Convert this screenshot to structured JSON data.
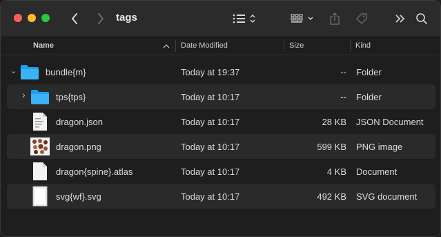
{
  "window": {
    "title": "tags"
  },
  "toolbar": {
    "back_icon": "chevron-left-icon",
    "forward_icon": "chevron-right-icon",
    "list_view_icon": "list-view-icon",
    "grid_view_icon": "grid-view-icon",
    "share_icon": "share-icon",
    "tag_icon": "tag-icon",
    "more_icon": "double-chevron-icon",
    "search_icon": "search-icon"
  },
  "columns": {
    "name": "Name",
    "date": "Date Modified",
    "size": "Size",
    "kind": "Kind"
  },
  "files": [
    {
      "disclosure": "⌄",
      "name": "bundle{m}",
      "date": "Today at 19:37",
      "size": "--",
      "kind": "Folder",
      "icon": "folder-icon"
    },
    {
      "disclosure": "›",
      "name": "tps{tps}",
      "date": "Today at 10:17",
      "size": "--",
      "kind": "Folder",
      "icon": "folder-icon"
    },
    {
      "disclosure": "",
      "name": "dragon.json",
      "date": "Today at 10:17",
      "size": "28 KB",
      "kind": "JSON Document",
      "icon": "json-document-icon"
    },
    {
      "disclosure": "",
      "name": "dragon.png",
      "date": "Today at 10:17",
      "size": "599 KB",
      "kind": "PNG image",
      "icon": "png-image-icon"
    },
    {
      "disclosure": "",
      "name": "dragon{spine}.atlas",
      "date": "Today at 10:17",
      "size": "4 KB",
      "kind": "Document",
      "icon": "document-icon"
    },
    {
      "disclosure": "",
      "name": "svg{wf}.svg",
      "date": "Today at 10:17",
      "size": "492 KB",
      "kind": "SVG document",
      "icon": "svg-document-icon"
    }
  ]
}
